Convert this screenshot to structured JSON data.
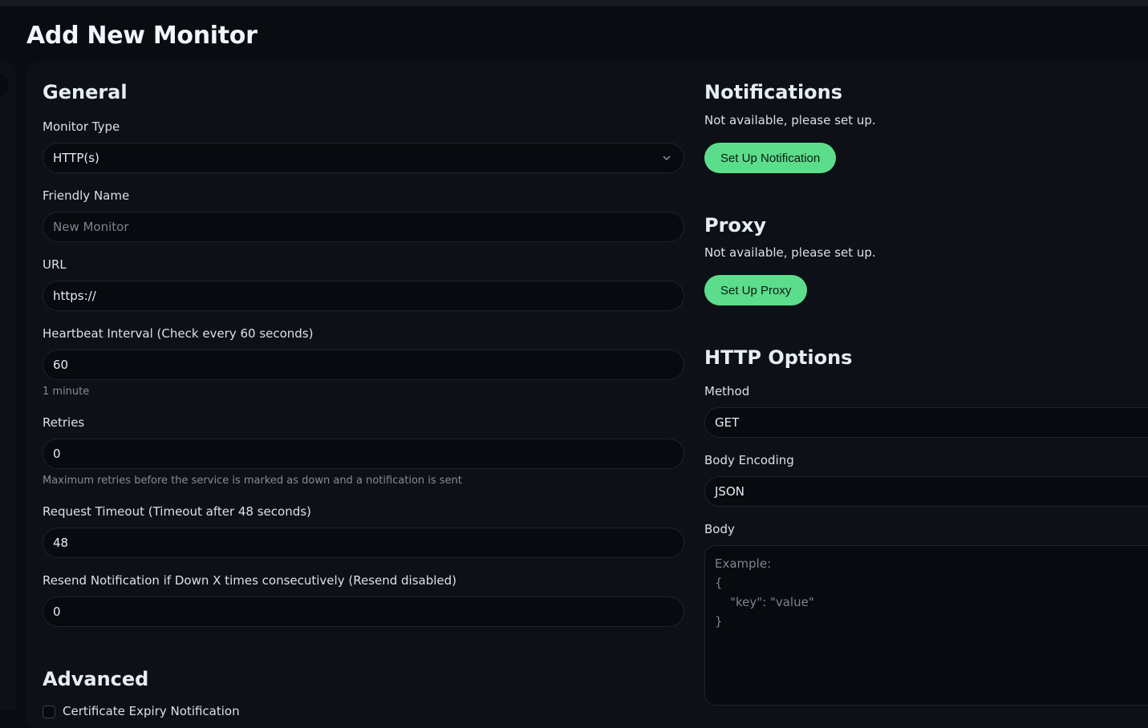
{
  "page": {
    "title": "Add New Monitor"
  },
  "general": {
    "title": "General",
    "monitor_type": {
      "label": "Monitor Type",
      "value": "HTTP(s)"
    },
    "friendly_name": {
      "label": "Friendly Name",
      "placeholder": "New Monitor"
    },
    "url": {
      "label": "URL",
      "value": "https://"
    },
    "heartbeat": {
      "label": "Heartbeat Interval (Check every 60 seconds)",
      "value": "60",
      "help": "1 minute"
    },
    "retries": {
      "label": "Retries",
      "value": "0",
      "help": "Maximum retries before the service is marked as down and a notification is sent"
    },
    "timeout": {
      "label": "Request Timeout (Timeout after 48 seconds)",
      "value": "48"
    },
    "resend": {
      "label": "Resend Notification if Down X times consecutively (Resend disabled)",
      "value": "0"
    }
  },
  "advanced": {
    "title": "Advanced",
    "cert_expiry_label": "Certificate Expiry Notification"
  },
  "notifications": {
    "title": "Notifications",
    "text": "Not available, please set up.",
    "button": "Set Up Notification"
  },
  "proxy": {
    "title": "Proxy",
    "text": "Not available, please set up.",
    "button": "Set Up Proxy"
  },
  "http_options": {
    "title": "HTTP Options",
    "method": {
      "label": "Method",
      "value": "GET"
    },
    "body_encoding": {
      "label": "Body Encoding",
      "value": "JSON"
    },
    "body": {
      "label": "Body",
      "placeholder": "Example:\n{\n    \"key\": \"value\"\n}"
    }
  },
  "colors": {
    "accent": "#5cdd8b",
    "background": "#090c10",
    "card": "#0d1117"
  },
  "icons": {
    "select_arrow": "chevron-down-icon"
  }
}
